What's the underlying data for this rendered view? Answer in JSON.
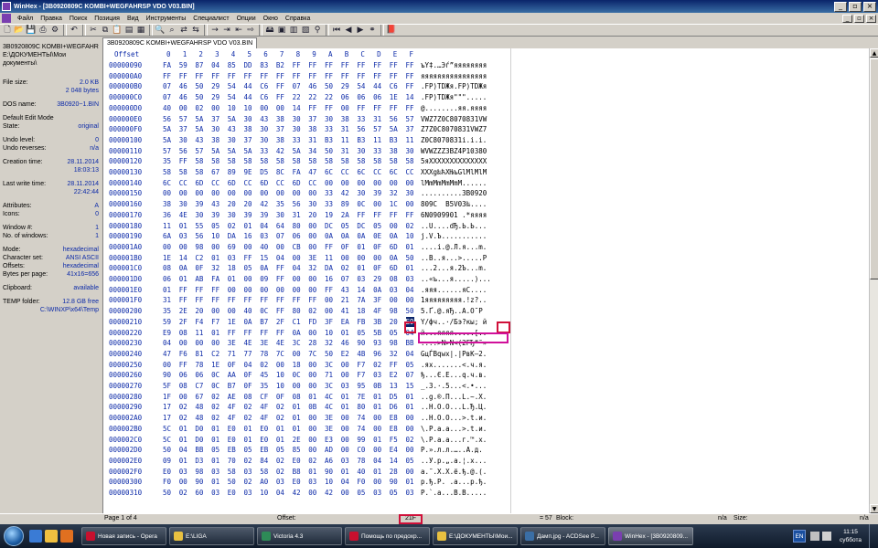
{
  "window": {
    "title": "WinHex - [3B0920809C  KOMBI+WEGFAHRSP VDO V03.BIN]"
  },
  "menu": [
    "Файл",
    "Правка",
    "Поиск",
    "Позиция",
    "Вид",
    "Инструменты",
    "Специалист",
    "Опции",
    "Окно",
    "Справка"
  ],
  "tab": {
    "label": "3B0920809C  KOMBI+WEGFAHRSP VDO V03.BIN"
  },
  "info": {
    "file_name": "3B0920809C  KOMBI+WEGFAHR",
    "file_path": "E:\\ДОКУМЕНТЫ\\Мои документы\\",
    "rows": [
      {
        "k": "File size:",
        "v": "2.0 KB"
      },
      {
        "k": "",
        "v": "2 048 bytes"
      },
      {
        "gap": true
      },
      {
        "k": "DOS name:",
        "v": "3B0920~1.BIN"
      },
      {
        "gap": true
      },
      {
        "k": "Default Edit Mode",
        "v": ""
      },
      {
        "k": "State:",
        "v": "original"
      },
      {
        "gap": true
      },
      {
        "k": "Undo level:",
        "v": "0"
      },
      {
        "k": "Undo reverses:",
        "v": "n/a"
      },
      {
        "gap": true
      },
      {
        "k": "Creation time:",
        "v": "28.11.2014"
      },
      {
        "k": "",
        "v": "18:03:13"
      },
      {
        "gap": true
      },
      {
        "k": "Last write time:",
        "v": "28.11.2014"
      },
      {
        "k": "",
        "v": "22:42:44"
      },
      {
        "gap": true
      },
      {
        "k": "Attributes:",
        "v": "A"
      },
      {
        "k": "Icons:",
        "v": "0"
      },
      {
        "gap": true
      },
      {
        "k": "Window #:",
        "v": "1"
      },
      {
        "k": "No. of windows:",
        "v": "1"
      },
      {
        "gap": true
      },
      {
        "k": "Mode:",
        "v": "hexadecimal"
      },
      {
        "k": "Character set:",
        "v": "ANSI ASCII"
      },
      {
        "k": "Offsets:",
        "v": "hexadecimal"
      },
      {
        "k": "Bytes per page:",
        "v": "41x16=656"
      },
      {
        "gap": true
      },
      {
        "k": "Clipboard:",
        "v": "available"
      },
      {
        "gap": true
      },
      {
        "k": "TEMP folder:",
        "v": "12.8 GB free"
      },
      {
        "k": "",
        "v": "C:\\WINXP\\x64\\Temp"
      }
    ]
  },
  "hex": {
    "offset_label": "Offset",
    "columns": [
      "0",
      "1",
      "2",
      "3",
      "4",
      "5",
      "6",
      "7",
      "8",
      "9",
      "A",
      "B",
      "C",
      "D",
      "E",
      "F"
    ],
    "rows": [
      {
        "off": "00000090",
        "bytes": "FA 59 87 04 85 DD 83 B2 FF FF FF FF FF FF FF FF",
        "asc": "ъY‡.…Эѓ”яяяяяяяя"
      },
      {
        "off": "000000A0",
        "bytes": "FF FF FF FF FF FF FF FF FF FF FF FF FF FF FF FF",
        "asc": "яяяяяяяяяяяяяяяя"
      },
      {
        "off": "000000B0",
        "bytes": "07 46 50 29 54 44 C6 FF 07 46 50 29 54 44 C6 FF",
        "asc": ".FP)TDЖя.FP)TDЖя"
      },
      {
        "off": "000000C0",
        "bytes": "07 46 50 29 54 44 C6 FF 22 22 22 06 06 06 1E 14",
        "asc": ".FP)TDЖя\"\"\"....."
      },
      {
        "off": "000000D0",
        "bytes": "40 00 02 00 10 10 00 00 14 FF FF 00 FF FF FF FF",
        "asc": "@........яя.яяяя"
      },
      {
        "off": "000000E0",
        "bytes": "56 57 5A 37 5A 30 43 38 30 37 30 38 33 31 56 57",
        "asc": "VWZ7Z0C8070831VW"
      },
      {
        "off": "000000F0",
        "bytes": "5A 37 5A 30 43 38 30 37 30 38 33 31 56 57 5A 37",
        "asc": "Z7Z0C8070831VWZ7"
      },
      {
        "off": "00000100",
        "bytes": "5A 30 43 38 30 37 30 38 33 31 B3 11 B3 11 B3 11",
        "asc": "Z0C8070831і.і.і."
      },
      {
        "off": "00000110",
        "bytes": "57 56 57 5A 5A 5A 33 42 5A 34 50 31 30 33 38 30",
        "asc": "WVWZZZ3BZ4P10380"
      },
      {
        "off": "00000120",
        "bytes": "35 FF 58 58 58 58 58 58 58 58 58 58 58 58 58 58",
        "asc": "5яXXXXXXXXXXXXXX"
      },
      {
        "off": "00000130",
        "bytes": "58 58 58 67 89 9E D5 8C FA 47 6C CC 6C CC 6C CC",
        "asc": "XXXg‰ћХЊъGlМlМlМ"
      },
      {
        "off": "00000140",
        "bytes": "6C CC 6D CC 6D CC 6D CC 6D CC 00 00 00 00 00 00",
        "asc": "lМmМmМmМmМ......"
      },
      {
        "off": "00000150",
        "bytes": "00 00 00 00 00 00 00 00 00 00 33 42 30 39 32 30",
        "asc": "..........3B0920"
      },
      {
        "off": "00000160",
        "bytes": "38 30 39 43 20 20 42 35 56 30 33 89 0C 00 1C 00",
        "asc": "809C  B5V03‰...."
      },
      {
        "off": "00000170",
        "bytes": "36 4E 30 39 30 39 39 30 31 20 19 2A FF FF FF FF",
        "asc": "6N0909901 .*яяяя"
      },
      {
        "off": "00000180",
        "bytes": "11 01 55 05 02 01 04 64 80 00 DC 05 DC 05 00 02",
        "asc": "..U....dЂ.Ь.Ь..."
      },
      {
        "off": "00000190",
        "bytes": "6A 03 56 10 DA 16 03 07 06 00 0A 0A 0A 0E 0A 10",
        "asc": "j.V.Ъ..........."
      },
      {
        "off": "000001A0",
        "bytes": "00 00 98 00 69 00 40 00 CB 00 FF 0F 01 0F 6D 01",
        "asc": "....i.@.Л.я...m."
      },
      {
        "off": "000001B0",
        "bytes": "1E 14 C2 01 03 FF 15 04 00 3E 11 00 00 00 0A 50",
        "asc": "..В..я...>.....P"
      },
      {
        "off": "000001C0",
        "bytes": "08 0A 0F 32 18 05 0A FF 04 32 DA 02 01 0F 6D 01",
        "asc": "...2...я.2Ъ...m."
      },
      {
        "off": "000001D0",
        "bytes": "06 01 AB FA 01 00 09 FF 00 00 16 07 03 29 08 03",
        "asc": "..«ъ...я.....)..."
      },
      {
        "off": "000001E0",
        "bytes": "01 FF FF FF 00 00 00 00 00 00 FF 43 14 0A 03 04",
        "asc": ".яяя......яC...."
      },
      {
        "off": "000001F0",
        "bytes": "31 FF FF FF FF FF FF FF FF FF 00 21 7A 3F 00 00",
        "asc": "1яяяяяяяяя.!z?.."
      },
      {
        "off": "00000200",
        "bytes": "35 2E 20 00 00 40 0C FF 80 02 00 41 18 4F 98 50",
        "asc": "5.Ґ.@.яЂ..A.O˜P"
      },
      {
        "off": "00000210",
        "bytes": "59 2F F4 F7 1E 0A B7 2F C1 FD 3F EA FB 3B 20 E9",
        "asc": "Y/фч..·/Бэ?кы; й"
      },
      {
        "off": "00000220",
        "bytes": "E9 08 11 01 FF FF FF FF 0A 00 10 01 05 5B 05 04",
        "asc": "й...яяяя.....[.."
      },
      {
        "off": "00000230",
        "bytes": "04 00 00 00 3E 4E 3E 4E 3C 28 32 46 90 93 98 BB",
        "asc": "....>N>N<(2FЂ“˜»"
      },
      {
        "off": "00000240",
        "bytes": "47 F6 81 C2 71 77 78 7C 00 7C 50 E2 4B 96 32 04",
        "asc": "GцЃВqwx|.|PвK–2."
      },
      {
        "off": "00000250",
        "bytes": "00 FF 78 1E 0F 04 02 00 18 00 3C 00 F7 02 FF 05",
        "asc": ".яx.......<.ч.я."
      },
      {
        "off": "00000260",
        "bytes": "90 06 06 0C AA 0F 45 10 0C 00 71 00 F7 03 E2 07",
        "asc": "ђ...Є.E...q.ч.в."
      },
      {
        "off": "00000270",
        "bytes": "5F 08 C7 0C B7 0F 35 10 00 00 3C 03 95 0B 13 15",
        "asc": "_.З.·.5...<.•..."
      },
      {
        "off": "00000280",
        "bytes": "1F 00 67 02 AE 08 CF 0F 08 01 4C 01 7E 01 D5 01",
        "asc": "..g.®.П...L.~.Х."
      },
      {
        "off": "00000290",
        "bytes": "17 02 48 02 4F 02 4F 02 01 0B 4C 01 80 01 D6 01",
        "asc": "..H.O.O...L.Ђ.Ц."
      },
      {
        "off": "000002A0",
        "bytes": "17 02 48 02 4F 02 4F 02 01 00 3E 00 74 00 E8 00",
        "asc": "..H.O.O...>.t.и."
      },
      {
        "off": "000002B0",
        "bytes": "5C 01 D0 01 E0 01 E0 01 01 00 3E 00 74 00 E8 00",
        "asc": "\\.Р.а.а...>.t.и."
      },
      {
        "off": "000002C0",
        "bytes": "5C 01 D0 01 E0 01 E0 01 2E 00 E3 00 99 01 F5 02",
        "asc": "\\.Р.а.а...г.™.х."
      },
      {
        "off": "000002D0",
        "bytes": "50 04 BB 05 EB 05 EB 05 85 00 AD 00 C0 00 E4 00",
        "asc": "P.».л.л.…..А.д."
      },
      {
        "off": "000002E0",
        "bytes": "09 01 D3 01 70 02 84 02 E0 02 A6 03 78 04 14 05",
        "asc": "..У.p.„.а.¦.x..."
      },
      {
        "off": "000002F0",
        "bytes": "E0 03 98 03 58 03 58 02 B8 01 90 01 40 01 28 00",
        "asc": "а.˜.X.X.ё.ђ.@.(."
      },
      {
        "off": "00000300",
        "bytes": "F0 00 90 01 50 02 A0 03 E0 03 10 04 F0 00 90 01",
        "asc": "р.ђ.P. .а...р.ђ."
      },
      {
        "off": "00000310",
        "bytes": "50 02 60 03 E0 03 10 04 42 00 42 00 05 03 05 03",
        "asc": "P.`.а...B.B....."
      }
    ]
  },
  "status": {
    "page": "Page 1 of 4",
    "offset_label": "Offset:",
    "offset_value": "21F",
    "eq": "= 57",
    "block_label": "Block:",
    "block_value": "n/a",
    "size_label": "Size:",
    "size_value": "n/a"
  },
  "taskbar": {
    "items": [
      {
        "label": "Новая запись - Opera",
        "color": "#c8102e",
        "active": false
      },
      {
        "label": "E:\\LIGA",
        "color": "#e8c040",
        "active": false
      },
      {
        "label": "Victoria 4.3",
        "color": "#2e8b57",
        "active": false
      },
      {
        "label": "Помощь по предохр...",
        "color": "#c8102e",
        "active": false
      },
      {
        "label": "E:\\ДОКУМЕНТЫ\\Мои...",
        "color": "#e8c040",
        "active": false
      },
      {
        "label": "Дамп.jpg - ACDSee P...",
        "color": "#3a6ea5",
        "active": false
      },
      {
        "label": "WinHex - [3B0920809...",
        "color": "#7a3fb0",
        "active": true
      }
    ],
    "lang": "EN",
    "time": "11:15",
    "day": "суббота"
  }
}
